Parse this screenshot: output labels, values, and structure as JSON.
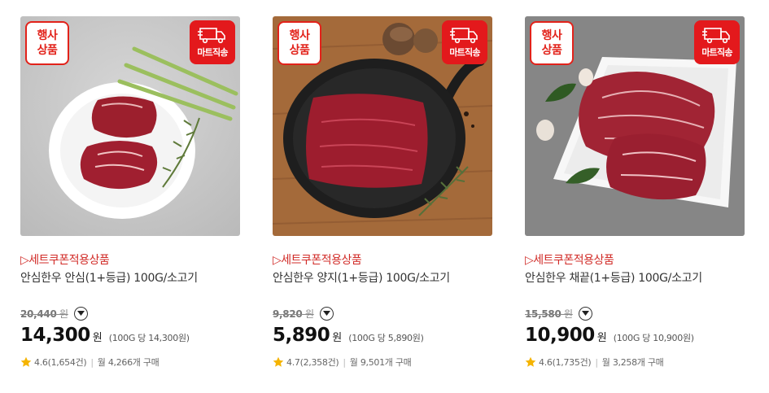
{
  "products": [
    {
      "event_badge": [
        "행사",
        "상품"
      ],
      "delivery_badge": "마트직송",
      "coupon_label": "▷세트쿠폰적용상품",
      "name": "안심한우 안심(1+등급) 100G/소고기",
      "original_price": "20,440",
      "original_unit": "원",
      "price": "14,300",
      "price_unit": "원",
      "unit_price": "(100G 당 14,300원)",
      "rating": "4.6(1,654건)",
      "monthly_sales": "월 4,266개 구매",
      "image": "beef-tenderloin-on-plate"
    },
    {
      "event_badge": [
        "행사",
        "상품"
      ],
      "delivery_badge": "마트직송",
      "coupon_label": "▷세트쿠폰적용상품",
      "name": "안심한우 양지(1+등급) 100G/소고기",
      "original_price": "9,820",
      "original_unit": "원",
      "price": "5,890",
      "price_unit": "원",
      "unit_price": "(100G 당 5,890원)",
      "rating": "4.7(2,358건)",
      "monthly_sales": "월 9,501개 구매",
      "image": "beef-brisket-on-board"
    },
    {
      "event_badge": [
        "행사",
        "상품"
      ],
      "delivery_badge": "마트직송",
      "coupon_label": "▷세트쿠폰적용상품",
      "name": "안심한우 채끝(1+등급) 100G/소고기",
      "original_price": "15,580",
      "original_unit": "원",
      "price": "10,900",
      "price_unit": "원",
      "unit_price": "(100G 당 10,900원)",
      "rating": "4.6(1,735건)",
      "monthly_sales": "월 3,258개 구매",
      "image": "beef-striploin-on-square-plate"
    }
  ],
  "colors": {
    "accent_red": "#e3191c",
    "coupon_red": "#d12b27",
    "star_yellow": "#f5b400",
    "text_dark": "#111111"
  }
}
